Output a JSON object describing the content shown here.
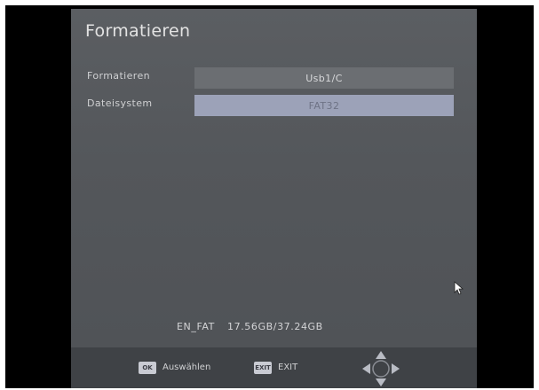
{
  "menu": {
    "title": "Formatieren",
    "rows": [
      {
        "label": "Formatieren",
        "value": "Usb1/C"
      },
      {
        "label": "Dateisystem",
        "value": "FAT32"
      }
    ]
  },
  "status": {
    "filesystem_label": "EN_FAT",
    "capacity": "17.56GB/37.24GB"
  },
  "footer": {
    "ok_key": "OK",
    "ok_label": "Auswählen",
    "exit_key": "EXIT",
    "exit_label": "EXIT"
  },
  "icons": {
    "navigation": "dpad-icon",
    "pointer": "mouse-cursor-icon"
  }
}
